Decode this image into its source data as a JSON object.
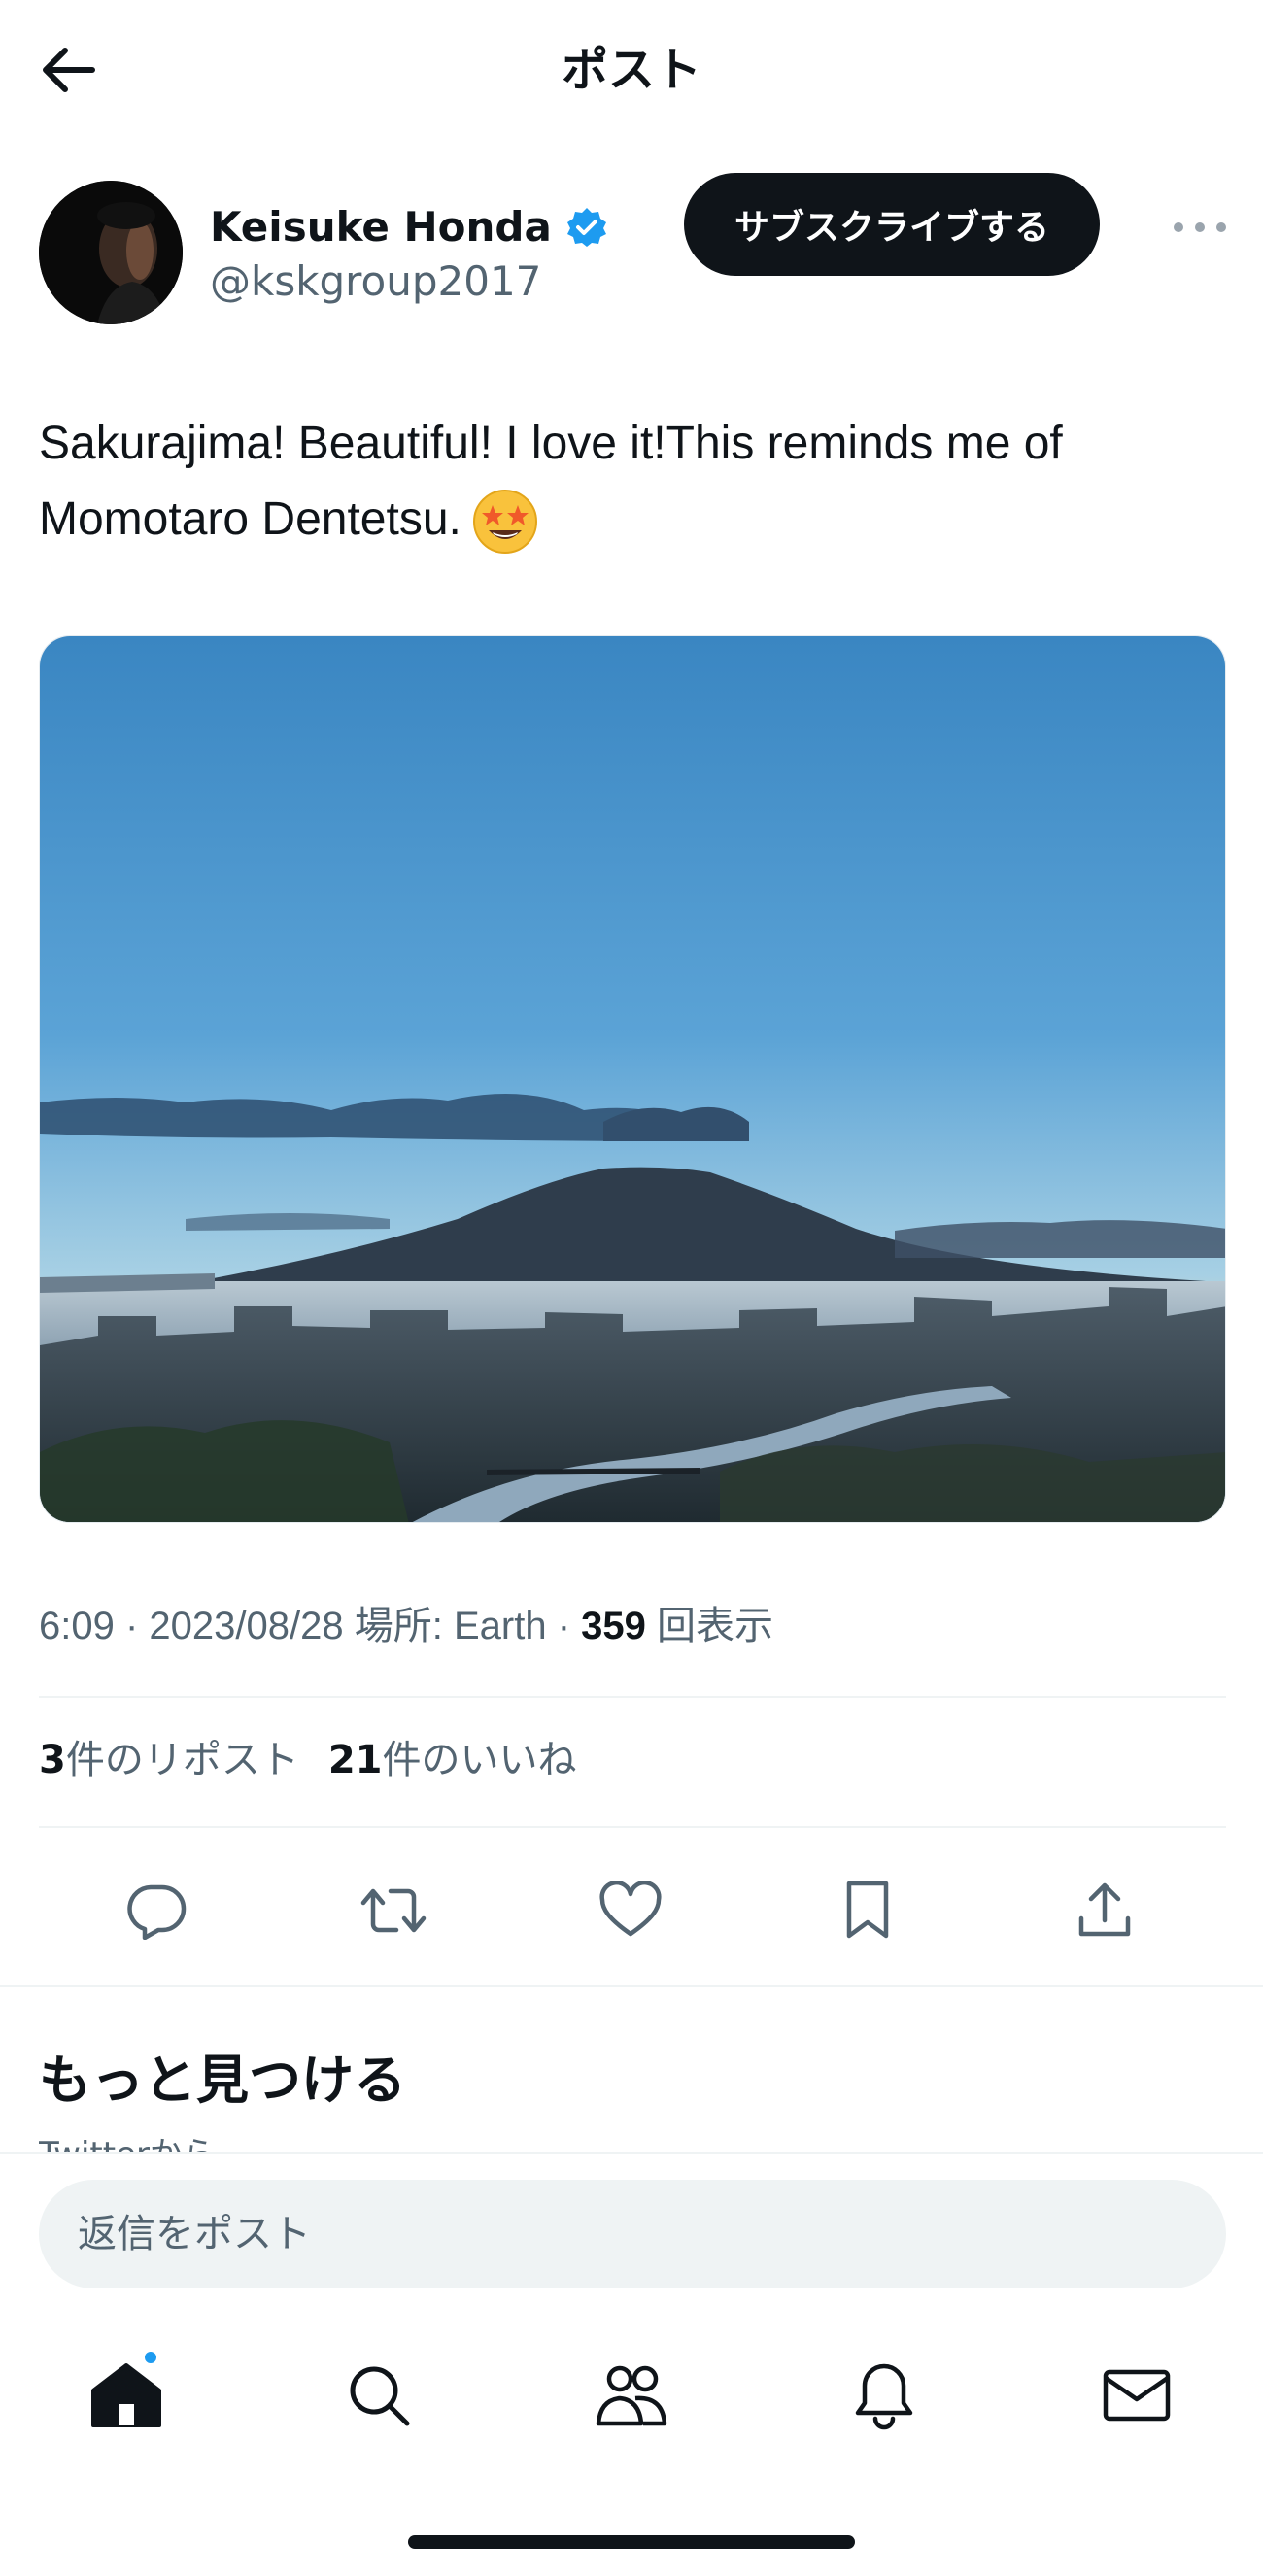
{
  "header": {
    "back_icon": "arrow-left-icon",
    "title": "ポスト"
  },
  "author": {
    "name": "Keisuke Honda",
    "handle": "@kskgroup2017",
    "verified_icon": "verified-badge-icon",
    "verified_color": "#1d9bf0",
    "subscribe_label": "サブスクライブする",
    "more_icon": "more-dots-icon"
  },
  "tweet": {
    "text": "Sakurajima! Beautiful! I love it!This reminds me of Momotaro Dentetsu.",
    "emoji_icon": "star-struck-emoji-icon",
    "image": "sakurajima-volcano-photo"
  },
  "meta": {
    "time": "6:09",
    "separator": " · ",
    "date": "2023/08/28",
    "location": "場所: Earth",
    "views_count": "359",
    "views_label": "回表示"
  },
  "stats": {
    "reposts_count": "3",
    "reposts_label": "件のリポスト",
    "likes_count": "21",
    "likes_label": "件のいいね"
  },
  "actions": [
    "reply-icon",
    "repost-icon",
    "like-icon",
    "bookmark-icon",
    "share-icon"
  ],
  "discover": {
    "title": "もっと見つける",
    "subtitle": "Twitterから"
  },
  "reply": {
    "placeholder": "返信をポスト"
  },
  "bottom_nav": [
    "home-icon",
    "search-icon",
    "communities-icon",
    "notifications-icon",
    "messages-icon"
  ],
  "colors": {
    "text": "#0f1419",
    "secondary": "#536471",
    "accent": "#1d9bf0",
    "divider": "#eff3f4"
  }
}
